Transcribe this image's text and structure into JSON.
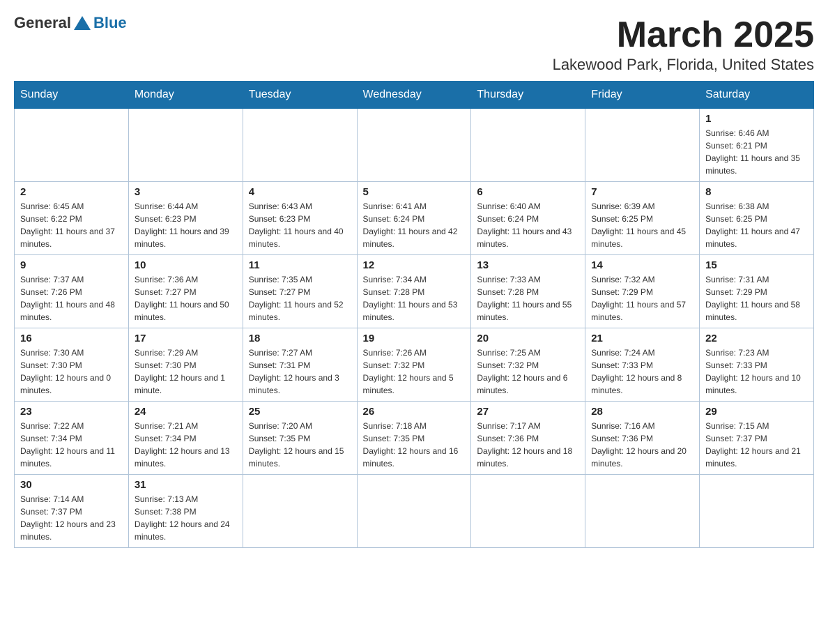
{
  "header": {
    "logo_general": "General",
    "logo_blue": "Blue",
    "month_title": "March 2025",
    "location": "Lakewood Park, Florida, United States"
  },
  "weekdays": [
    "Sunday",
    "Monday",
    "Tuesday",
    "Wednesday",
    "Thursday",
    "Friday",
    "Saturday"
  ],
  "weeks": [
    [
      {
        "day": "",
        "sunrise": "",
        "sunset": "",
        "daylight": ""
      },
      {
        "day": "",
        "sunrise": "",
        "sunset": "",
        "daylight": ""
      },
      {
        "day": "",
        "sunrise": "",
        "sunset": "",
        "daylight": ""
      },
      {
        "day": "",
        "sunrise": "",
        "sunset": "",
        "daylight": ""
      },
      {
        "day": "",
        "sunrise": "",
        "sunset": "",
        "daylight": ""
      },
      {
        "day": "",
        "sunrise": "",
        "sunset": "",
        "daylight": ""
      },
      {
        "day": "1",
        "sunrise": "Sunrise: 6:46 AM",
        "sunset": "Sunset: 6:21 PM",
        "daylight": "Daylight: 11 hours and 35 minutes."
      }
    ],
    [
      {
        "day": "2",
        "sunrise": "Sunrise: 6:45 AM",
        "sunset": "Sunset: 6:22 PM",
        "daylight": "Daylight: 11 hours and 37 minutes."
      },
      {
        "day": "3",
        "sunrise": "Sunrise: 6:44 AM",
        "sunset": "Sunset: 6:23 PM",
        "daylight": "Daylight: 11 hours and 39 minutes."
      },
      {
        "day": "4",
        "sunrise": "Sunrise: 6:43 AM",
        "sunset": "Sunset: 6:23 PM",
        "daylight": "Daylight: 11 hours and 40 minutes."
      },
      {
        "day": "5",
        "sunrise": "Sunrise: 6:41 AM",
        "sunset": "Sunset: 6:24 PM",
        "daylight": "Daylight: 11 hours and 42 minutes."
      },
      {
        "day": "6",
        "sunrise": "Sunrise: 6:40 AM",
        "sunset": "Sunset: 6:24 PM",
        "daylight": "Daylight: 11 hours and 43 minutes."
      },
      {
        "day": "7",
        "sunrise": "Sunrise: 6:39 AM",
        "sunset": "Sunset: 6:25 PM",
        "daylight": "Daylight: 11 hours and 45 minutes."
      },
      {
        "day": "8",
        "sunrise": "Sunrise: 6:38 AM",
        "sunset": "Sunset: 6:25 PM",
        "daylight": "Daylight: 11 hours and 47 minutes."
      }
    ],
    [
      {
        "day": "9",
        "sunrise": "Sunrise: 7:37 AM",
        "sunset": "Sunset: 7:26 PM",
        "daylight": "Daylight: 11 hours and 48 minutes."
      },
      {
        "day": "10",
        "sunrise": "Sunrise: 7:36 AM",
        "sunset": "Sunset: 7:27 PM",
        "daylight": "Daylight: 11 hours and 50 minutes."
      },
      {
        "day": "11",
        "sunrise": "Sunrise: 7:35 AM",
        "sunset": "Sunset: 7:27 PM",
        "daylight": "Daylight: 11 hours and 52 minutes."
      },
      {
        "day": "12",
        "sunrise": "Sunrise: 7:34 AM",
        "sunset": "Sunset: 7:28 PM",
        "daylight": "Daylight: 11 hours and 53 minutes."
      },
      {
        "day": "13",
        "sunrise": "Sunrise: 7:33 AM",
        "sunset": "Sunset: 7:28 PM",
        "daylight": "Daylight: 11 hours and 55 minutes."
      },
      {
        "day": "14",
        "sunrise": "Sunrise: 7:32 AM",
        "sunset": "Sunset: 7:29 PM",
        "daylight": "Daylight: 11 hours and 57 minutes."
      },
      {
        "day": "15",
        "sunrise": "Sunrise: 7:31 AM",
        "sunset": "Sunset: 7:29 PM",
        "daylight": "Daylight: 11 hours and 58 minutes."
      }
    ],
    [
      {
        "day": "16",
        "sunrise": "Sunrise: 7:30 AM",
        "sunset": "Sunset: 7:30 PM",
        "daylight": "Daylight: 12 hours and 0 minutes."
      },
      {
        "day": "17",
        "sunrise": "Sunrise: 7:29 AM",
        "sunset": "Sunset: 7:30 PM",
        "daylight": "Daylight: 12 hours and 1 minute."
      },
      {
        "day": "18",
        "sunrise": "Sunrise: 7:27 AM",
        "sunset": "Sunset: 7:31 PM",
        "daylight": "Daylight: 12 hours and 3 minutes."
      },
      {
        "day": "19",
        "sunrise": "Sunrise: 7:26 AM",
        "sunset": "Sunset: 7:32 PM",
        "daylight": "Daylight: 12 hours and 5 minutes."
      },
      {
        "day": "20",
        "sunrise": "Sunrise: 7:25 AM",
        "sunset": "Sunset: 7:32 PM",
        "daylight": "Daylight: 12 hours and 6 minutes."
      },
      {
        "day": "21",
        "sunrise": "Sunrise: 7:24 AM",
        "sunset": "Sunset: 7:33 PM",
        "daylight": "Daylight: 12 hours and 8 minutes."
      },
      {
        "day": "22",
        "sunrise": "Sunrise: 7:23 AM",
        "sunset": "Sunset: 7:33 PM",
        "daylight": "Daylight: 12 hours and 10 minutes."
      }
    ],
    [
      {
        "day": "23",
        "sunrise": "Sunrise: 7:22 AM",
        "sunset": "Sunset: 7:34 PM",
        "daylight": "Daylight: 12 hours and 11 minutes."
      },
      {
        "day": "24",
        "sunrise": "Sunrise: 7:21 AM",
        "sunset": "Sunset: 7:34 PM",
        "daylight": "Daylight: 12 hours and 13 minutes."
      },
      {
        "day": "25",
        "sunrise": "Sunrise: 7:20 AM",
        "sunset": "Sunset: 7:35 PM",
        "daylight": "Daylight: 12 hours and 15 minutes."
      },
      {
        "day": "26",
        "sunrise": "Sunrise: 7:18 AM",
        "sunset": "Sunset: 7:35 PM",
        "daylight": "Daylight: 12 hours and 16 minutes."
      },
      {
        "day": "27",
        "sunrise": "Sunrise: 7:17 AM",
        "sunset": "Sunset: 7:36 PM",
        "daylight": "Daylight: 12 hours and 18 minutes."
      },
      {
        "day": "28",
        "sunrise": "Sunrise: 7:16 AM",
        "sunset": "Sunset: 7:36 PM",
        "daylight": "Daylight: 12 hours and 20 minutes."
      },
      {
        "day": "29",
        "sunrise": "Sunrise: 7:15 AM",
        "sunset": "Sunset: 7:37 PM",
        "daylight": "Daylight: 12 hours and 21 minutes."
      }
    ],
    [
      {
        "day": "30",
        "sunrise": "Sunrise: 7:14 AM",
        "sunset": "Sunset: 7:37 PM",
        "daylight": "Daylight: 12 hours and 23 minutes."
      },
      {
        "day": "31",
        "sunrise": "Sunrise: 7:13 AM",
        "sunset": "Sunset: 7:38 PM",
        "daylight": "Daylight: 12 hours and 24 minutes."
      },
      {
        "day": "",
        "sunrise": "",
        "sunset": "",
        "daylight": ""
      },
      {
        "day": "",
        "sunrise": "",
        "sunset": "",
        "daylight": ""
      },
      {
        "day": "",
        "sunrise": "",
        "sunset": "",
        "daylight": ""
      },
      {
        "day": "",
        "sunrise": "",
        "sunset": "",
        "daylight": ""
      },
      {
        "day": "",
        "sunrise": "",
        "sunset": "",
        "daylight": ""
      }
    ]
  ],
  "colors": {
    "header_bg": "#1a6fa8",
    "header_text": "#ffffff",
    "border": "#b0c4d8",
    "logo_blue": "#1a6fa8"
  }
}
